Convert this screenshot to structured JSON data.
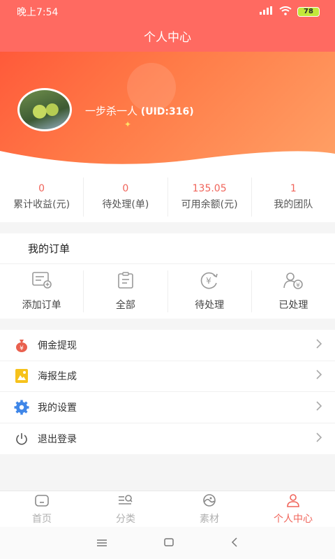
{
  "status_bar": {
    "time": "晚上7:54",
    "battery": "78"
  },
  "header": {
    "title": "个人中心"
  },
  "profile": {
    "name": "一步杀一人",
    "uid": "(UID:316)"
  },
  "stats": [
    {
      "value": "0",
      "label": "累计收益(元)"
    },
    {
      "value": "0",
      "label": "待处理(单)"
    },
    {
      "value": "135.05",
      "label": "可用余额(元)"
    },
    {
      "value": "1",
      "label": "我的团队"
    }
  ],
  "orders": {
    "title": "我的订单",
    "items": [
      {
        "label": "添加订单",
        "icon": "add-order-icon"
      },
      {
        "label": "全部",
        "icon": "clipboard-icon"
      },
      {
        "label": "待处理",
        "icon": "yen-refresh-icon"
      },
      {
        "label": "已处理",
        "icon": "user-yen-icon"
      }
    ]
  },
  "menu": [
    {
      "label": "佣金提现",
      "icon": "money-bag-icon"
    },
    {
      "label": "海报生成",
      "icon": "poster-icon"
    },
    {
      "label": "我的设置",
      "icon": "gear-icon"
    },
    {
      "label": "退出登录",
      "icon": "power-icon"
    }
  ],
  "tabs": [
    {
      "label": "首页",
      "icon": "home-icon"
    },
    {
      "label": "分类",
      "icon": "category-search-icon"
    },
    {
      "label": "素材",
      "icon": "material-icon"
    },
    {
      "label": "个人中心",
      "icon": "person-icon",
      "active": true
    }
  ],
  "colors": {
    "accent": "#f0645a",
    "header": "#ff6a61"
  }
}
